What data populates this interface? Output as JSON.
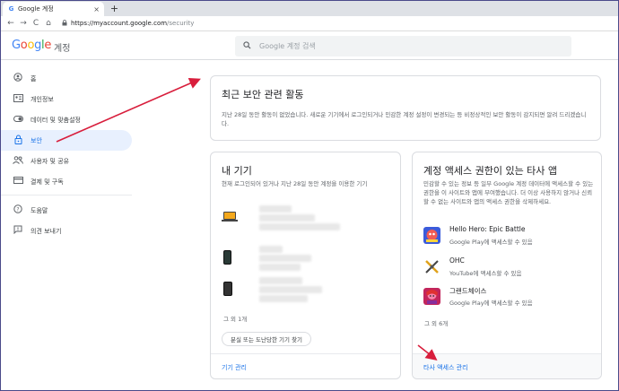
{
  "browser": {
    "tab_title": "Google 계정",
    "tab_favicon": "G",
    "tab_close": "×",
    "newtab": "+",
    "back": "←",
    "forward": "→",
    "reload": "C",
    "home": "⌂",
    "lock": "🔒",
    "url_host": "https://myaccount.google.com",
    "url_path": "/security"
  },
  "header": {
    "logo": [
      "G",
      "o",
      "o",
      "g",
      "l",
      "e"
    ],
    "subtitle": "계정",
    "search_placeholder": "Google 계정 검색"
  },
  "sidebar": {
    "items": [
      {
        "label": "홈",
        "icon": "home-icon"
      },
      {
        "label": "개인정보",
        "icon": "id-card-icon"
      },
      {
        "label": "데이터 및 맞춤설정",
        "icon": "toggle-icon"
      },
      {
        "label": "보안",
        "icon": "lock-icon",
        "active": true
      },
      {
        "label": "사용자 및 공유",
        "icon": "people-icon"
      },
      {
        "label": "결제 및 구독",
        "icon": "credit-card-icon"
      }
    ],
    "secondary": [
      {
        "label": "도움말",
        "icon": "help-icon"
      },
      {
        "label": "의견 보내기",
        "icon": "feedback-icon"
      }
    ]
  },
  "recent_security": {
    "title": "최근 보안 관련 활동",
    "text": "지난 28일 동안 활동이 없었습니다. 새로운 기기에서 로그인되거나 민감한 계정 설정이 변경되는 등 비정상적인 보안 활동이 감지되면 알려 드리겠습니다."
  },
  "devices": {
    "title": "내 기기",
    "text": "현재 로그인되어 있거나 지난 28일 동안 계정을 이용한 기기",
    "more": "그 외 1개",
    "find_button": "분실 또는 도난당한 기기 찾기",
    "manage_link": "기기 관리"
  },
  "third_party": {
    "title": "계정 액세스 권한이 있는 타사 앱",
    "text": "민감할 수 있는 정보 등 일부 Google 계정 데이터에 액세스할 수 있는 권한을 이 사이트와 앱에 부여했습니다. 더 이상 사용하지 않거나 신뢰할 수 없는 사이트와 앱의 액세스 권한을 삭제하세요.",
    "apps": [
      {
        "name": "Hello Hero: Epic Battle",
        "access": "Google Play에 액세스할 수 있음"
      },
      {
        "name": "OHC",
        "access": "YouTube에 액세스할 수 있음"
      },
      {
        "name": "그랜드체이스",
        "access": "Google Play에 액세스할 수 있음"
      }
    ],
    "more": "그 외 6개",
    "manage_link": "타사 액세스 관리"
  },
  "colors": {
    "accent": "#1a73e8",
    "annotation": "#d81e3c"
  }
}
